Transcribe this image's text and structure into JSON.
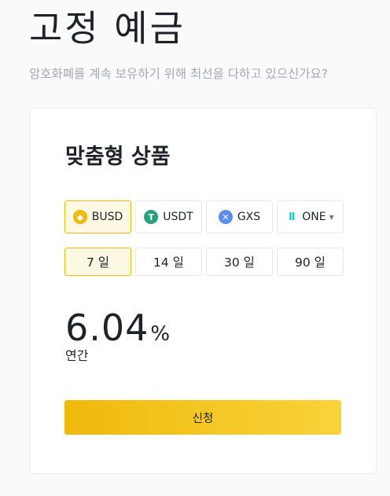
{
  "header": {
    "title": "고정 예금",
    "subtitle": "암호화폐를 계속 보유하기 위해 최선을 다하고 있으신가요?"
  },
  "card": {
    "title": "맞춤형 상품",
    "assets": [
      {
        "label": "BUSD",
        "icon": "busd-coin-icon",
        "glyph": "◆",
        "selected": true
      },
      {
        "label": "USDT",
        "icon": "usdt-coin-icon",
        "glyph": "T",
        "selected": false
      },
      {
        "label": "GXS",
        "icon": "gxs-coin-icon",
        "glyph": "✕",
        "selected": false
      },
      {
        "label": "ONE",
        "icon": "harmony-one-coin-icon",
        "glyph": "Ⅱ",
        "selected": false,
        "dropdown": true
      }
    ],
    "durations": [
      {
        "label": "7 일",
        "selected": true
      },
      {
        "label": "14 일",
        "selected": false
      },
      {
        "label": "30 일",
        "selected": false
      },
      {
        "label": "90 일",
        "selected": false
      }
    ],
    "rate_value": "6.04",
    "rate_unit": "%",
    "rate_label": "연간",
    "apply_label": "신청"
  },
  "colors": {
    "accent": "#f0b90b",
    "accent_light": "#f8d33a",
    "selected_bg": "#fdf8e1",
    "text": "#1e2329",
    "muted": "#a4a9b1"
  }
}
